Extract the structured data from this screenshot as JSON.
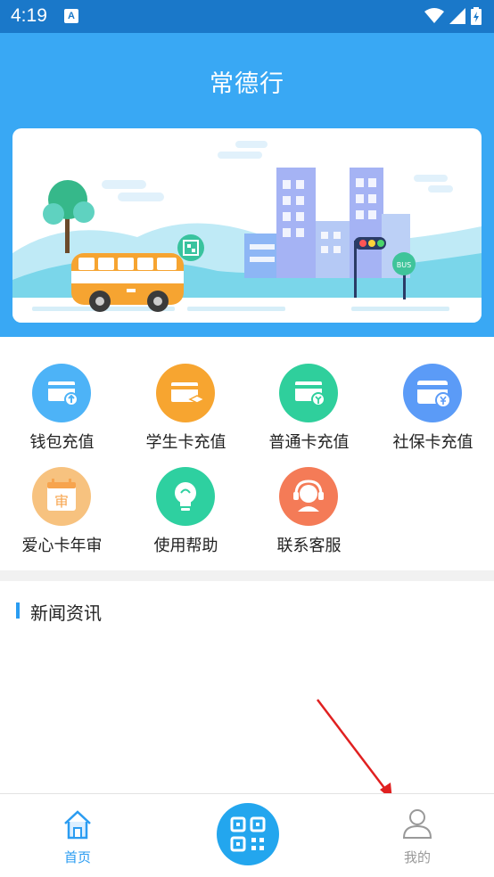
{
  "status_bar": {
    "time": "4:19",
    "notification_badge": "A"
  },
  "header": {
    "title": "常德行"
  },
  "banner": {
    "bus_sign": "BUS"
  },
  "menu": {
    "items": [
      {
        "label": "钱包充值",
        "color": "#4db3f7",
        "icon": "wallet-recharge-icon"
      },
      {
        "label": "学生卡充值",
        "color": "#f7a530",
        "icon": "student-card-icon"
      },
      {
        "label": "普通卡充值",
        "color": "#2fcf9c",
        "icon": "regular-card-icon"
      },
      {
        "label": "社保卡充值",
        "color": "#5b9bf7",
        "icon": "social-security-card-icon"
      },
      {
        "label": "爱心卡年审",
        "color": "#f7c27f",
        "icon": "annual-review-icon",
        "glyph": "审"
      },
      {
        "label": "使用帮助",
        "color": "#2ed0a0",
        "icon": "help-bulb-icon"
      },
      {
        "label": "联系客服",
        "color": "#f47b57",
        "icon": "customer-service-icon"
      }
    ]
  },
  "news": {
    "title": "新闻资讯"
  },
  "tabbar": {
    "home_label": "首页",
    "mine_label": "我的",
    "active_color": "#2a9cf1",
    "inactive_color": "#999999"
  }
}
